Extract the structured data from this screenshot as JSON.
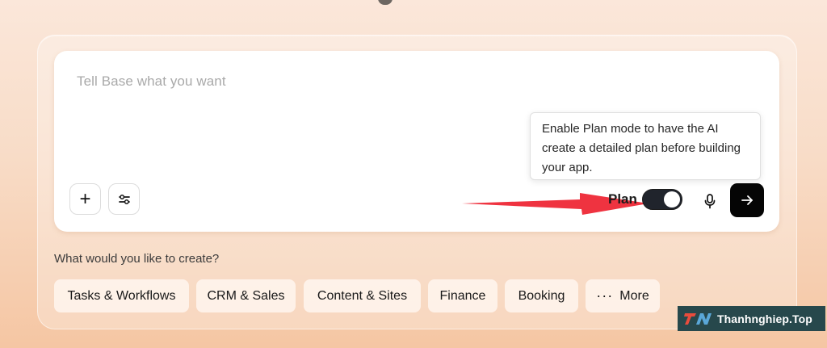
{
  "prompt": {
    "placeholder": "Tell Base what you want"
  },
  "tooltip": {
    "text": "Enable Plan mode to have the AI create a detailed plan before building your app."
  },
  "plan_toggle": {
    "label": "Plan",
    "enabled": true
  },
  "create": {
    "question": "What would you like to create?",
    "chips": [
      "Tasks & Workflows",
      "CRM & Sales",
      "Content & Sites",
      "Finance",
      "Booking"
    ],
    "more_label": "More"
  },
  "watermark": {
    "logo_text": "TN",
    "text": "Thanhnghiep.Top"
  },
  "icons": {
    "plus": "plus-icon",
    "settings": "sliders-icon",
    "mic": "microphone-icon",
    "send": "arrow-right-icon",
    "more": "ellipsis-icon",
    "annotation": "red-arrow-icon"
  },
  "colors": {
    "send_button": "#050505",
    "toggle_on": "#20242c",
    "arrow": "#ef3340",
    "watermark_bg": "#27484c"
  }
}
